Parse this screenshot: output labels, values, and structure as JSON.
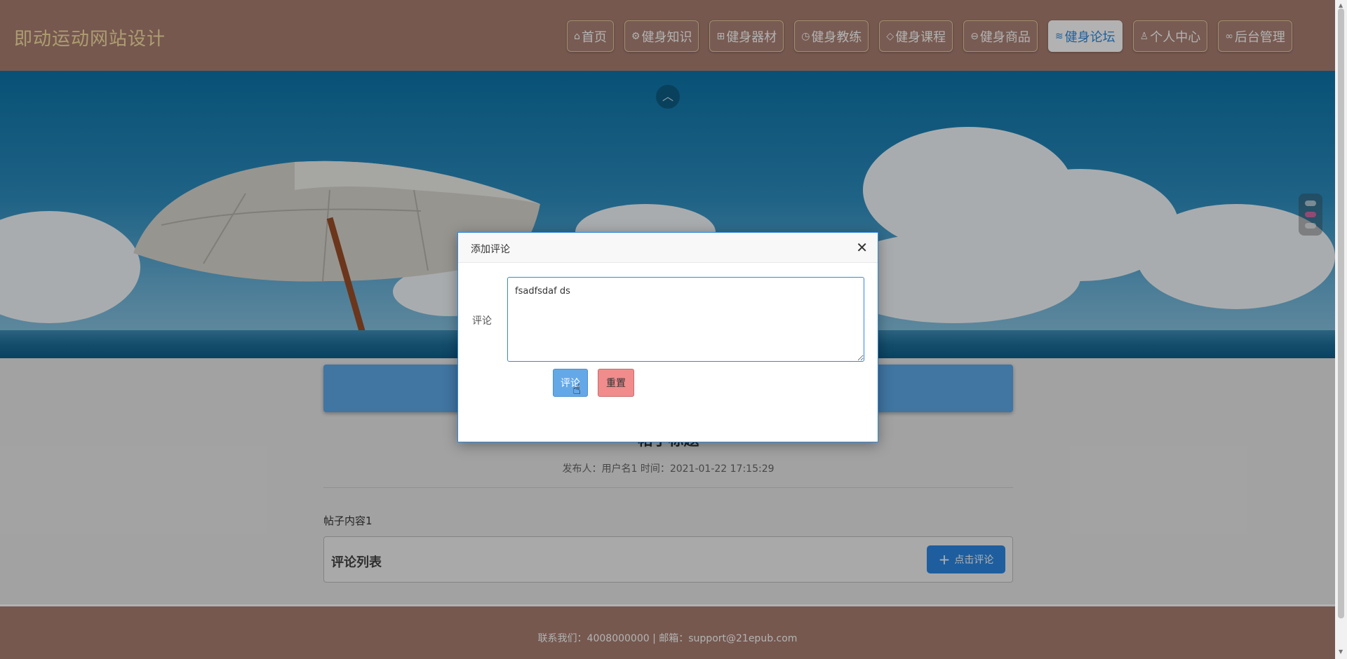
{
  "site": {
    "title": "即动运动网站设计"
  },
  "nav": {
    "items": [
      {
        "icon": "home-icon",
        "glyph": "⌂",
        "label": "首页"
      },
      {
        "icon": "gear-icon",
        "glyph": "⚙",
        "label": "健身知识"
      },
      {
        "icon": "gift-icon",
        "glyph": "⊞",
        "label": "健身器材"
      },
      {
        "icon": "gauge-icon",
        "glyph": "◷",
        "label": "健身教练"
      },
      {
        "icon": "tag-icon",
        "glyph": "◇",
        "label": "健身课程"
      },
      {
        "icon": "cart-icon",
        "glyph": "⊖",
        "label": "健身商品"
      },
      {
        "icon": "layers-icon",
        "glyph": "≋",
        "label": "健身论坛",
        "active": true
      },
      {
        "icon": "user-icon",
        "glyph": "♙",
        "label": "个人中心"
      },
      {
        "icon": "link-icon",
        "glyph": "∞",
        "label": "后台管理"
      }
    ]
  },
  "banner": {
    "up_glyph": "︿"
  },
  "post": {
    "title": "帖子标题",
    "meta": "发布人：用户名1 时间：2021-01-22 17:15:29",
    "body": "帖子内容1"
  },
  "comments": {
    "title": "评论列表",
    "add_button": "点击评论",
    "add_glyph": "+"
  },
  "footer": {
    "text": "联系我们：4008000000 | 邮箱：support@21epub.com"
  },
  "modal": {
    "title": "添加评论",
    "close_glyph": "✕",
    "field_label": "评论",
    "field_value": "fsadfsdaf ds",
    "submit_label": "评论",
    "reset_label": "重置"
  }
}
